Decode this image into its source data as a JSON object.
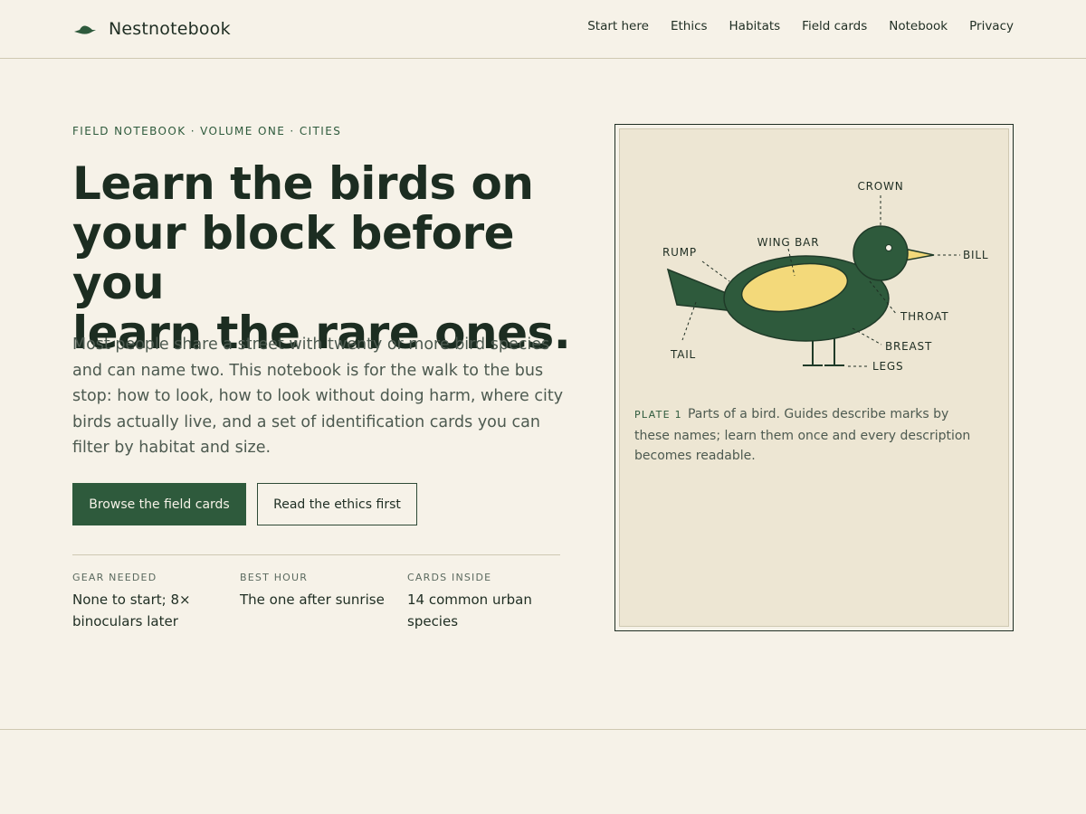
{
  "brand": {
    "name": "Nestnotebook",
    "icon": "bird-logo-icon"
  },
  "nav": [
    "Start here",
    "Ethics",
    "Habitats",
    "Field cards",
    "Notebook",
    "Privacy"
  ],
  "hero": {
    "eyebrow": "FIELD NOTEBOOK · VOLUME ONE · CITIES",
    "headline_lines": [
      "Learn the birds on",
      "your block before you",
      "learn the rare ones."
    ],
    "lead": "Most people share a street with twenty or more bird species and can name two. This notebook is for the walk to the bus stop: how to look, how to look without doing harm, where city birds actually live, and a set of identification cards you can filter by habitat and size.",
    "primary_button": "Browse the field cards",
    "secondary_button": "Read the ethics first"
  },
  "stats": [
    {
      "label": "GEAR NEEDED",
      "value": "None to start; 8× binoculars later"
    },
    {
      "label": "BEST HOUR",
      "value": "The one after sunrise"
    },
    {
      "label": "CARDS INSIDE",
      "value": "14 common urban species"
    }
  ],
  "plate": {
    "labels": {
      "crown": "CROWN",
      "wing_bar": "WING BAR",
      "rump": "RUMP",
      "bill": "BILL",
      "throat": "THROAT",
      "breast": "BREAST",
      "legs": "LEGS",
      "tail": "TAIL"
    },
    "number": "PLATE 1",
    "caption": "Parts of a bird. Guides describe marks by these names; learn them once and every description becomes readable."
  },
  "colors": {
    "accent": "#2e5a3c",
    "background": "#f6f2e8",
    "plate_bg": "#ede6d3",
    "wing": "#f3d97a",
    "text": "#1f2e23"
  }
}
